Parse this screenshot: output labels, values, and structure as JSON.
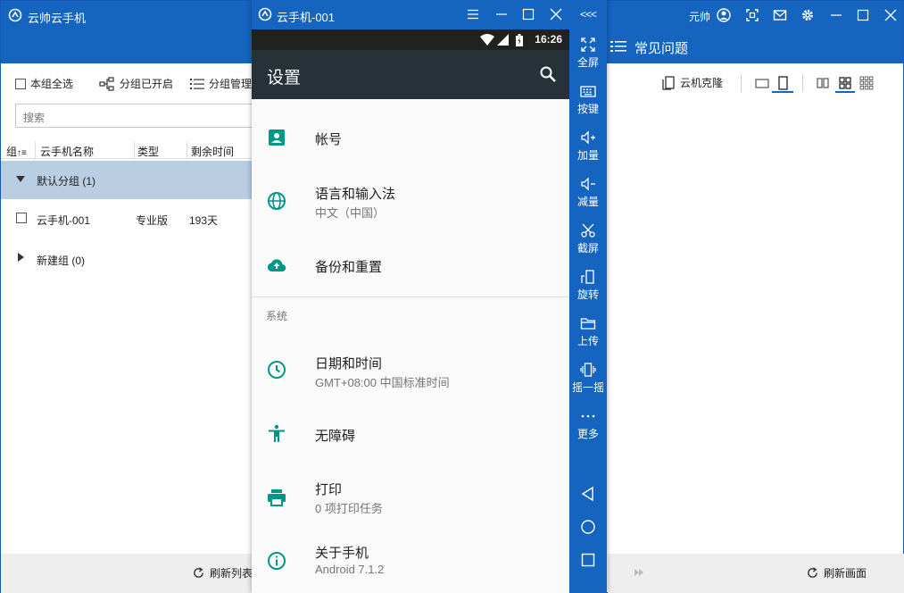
{
  "app": {
    "title": "云帅云手机",
    "user": "元帅"
  },
  "left_panel": {
    "select_all": "本组全选",
    "group_on": "分组已开启",
    "group_manage": "分组管理",
    "search_placeholder": "搜索",
    "columns": {
      "group": "组",
      "name": "云手机名称",
      "type": "类型",
      "remaining": "剩余时间"
    },
    "groups": [
      {
        "label": "默认分组 (1)",
        "expanded": true
      },
      {
        "label": "新建组 (0)",
        "expanded": false
      }
    ],
    "devices": [
      {
        "name": "云手机-001",
        "type": "专业版",
        "remaining": "193天"
      }
    ],
    "refresh_list": "刷新列表"
  },
  "phone": {
    "window_title": "云手机-001",
    "status_time": "16:26",
    "app_bar_title": "设置",
    "items": [
      {
        "title": "帐号",
        "subtitle": "",
        "icon": "account-icon"
      },
      {
        "title": "语言和输入法",
        "subtitle": "中文（中国）",
        "icon": "globe-icon"
      },
      {
        "title": "备份和重置",
        "subtitle": "",
        "icon": "cloud-upload-icon"
      },
      {
        "title": "日期和时间",
        "subtitle": "GMT+08:00 中国标准时间",
        "icon": "clock-icon"
      },
      {
        "title": "无障碍",
        "subtitle": "",
        "icon": "accessibility-icon"
      },
      {
        "title": "打印",
        "subtitle": "0 项打印任务",
        "icon": "printer-icon"
      },
      {
        "title": "关于手机",
        "subtitle": "Android 7.1.2",
        "icon": "info-icon"
      }
    ],
    "section_system": "系统"
  },
  "side_toolbar": {
    "collapse": "<<<",
    "buttons": [
      {
        "label": "全屏",
        "icon": "fullscreen-icon"
      },
      {
        "label": "按键",
        "icon": "keyboard-icon"
      },
      {
        "label": "加量",
        "icon": "volume-up-icon"
      },
      {
        "label": "减量",
        "icon": "volume-down-icon"
      },
      {
        "label": "截屏",
        "icon": "screenshot-icon"
      },
      {
        "label": "旋转",
        "icon": "rotate-icon"
      },
      {
        "label": "上传",
        "icon": "upload-folder-icon"
      },
      {
        "label": "摇一摇",
        "icon": "shake-icon"
      },
      {
        "label": "更多",
        "icon": "more-icon"
      }
    ]
  },
  "right_panel": {
    "faq_title": "常见问题",
    "cloud_clone": "云机克隆",
    "refresh_screen": "刷新画面"
  },
  "colors": {
    "brand_blue": "#1565c0",
    "app_bar": "#263238",
    "status_bar": "#212121",
    "teal_icon": "#009688",
    "group_selected": "#b9cde3"
  }
}
